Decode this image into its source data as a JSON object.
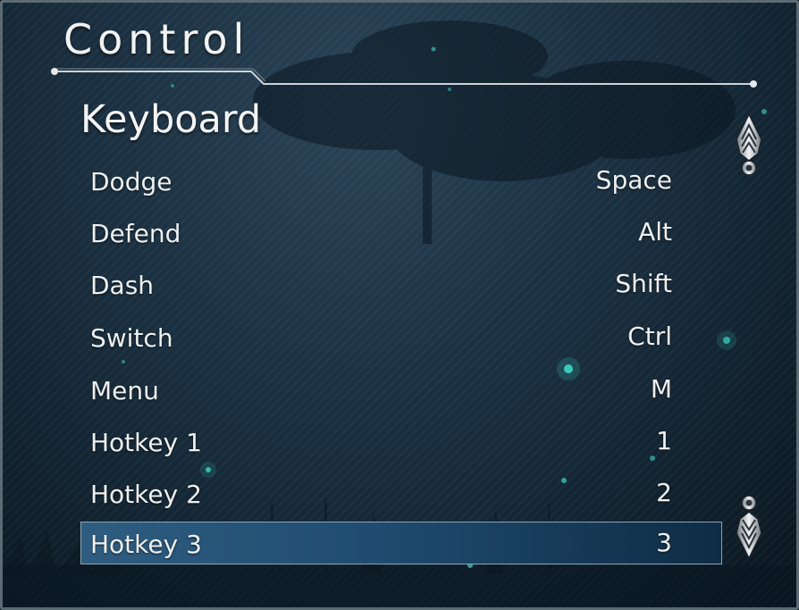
{
  "header": {
    "title": "Control"
  },
  "section": {
    "title": "Keyboard"
  },
  "bindings": [
    {
      "action": "Dodge",
      "key": "Space"
    },
    {
      "action": "Defend",
      "key": "Alt"
    },
    {
      "action": "Dash",
      "key": "Shift"
    },
    {
      "action": "Switch",
      "key": "Ctrl"
    },
    {
      "action": "Menu",
      "key": "M"
    },
    {
      "action": "Hotkey 1",
      "key": "1"
    },
    {
      "action": "Hotkey 2",
      "key": "2"
    },
    {
      "action": "Hotkey 3",
      "key": "3"
    }
  ],
  "selected_binding": "Hotkey 3",
  "colors": {
    "background": "#12212d",
    "text": "#eef0f0",
    "selection": "#2f5d80",
    "accent_glow": "#3fd6c8"
  },
  "icons": {
    "scroll_up": "ornate-scroll-up-icon",
    "scroll_down": "ornate-scroll-down-icon"
  }
}
